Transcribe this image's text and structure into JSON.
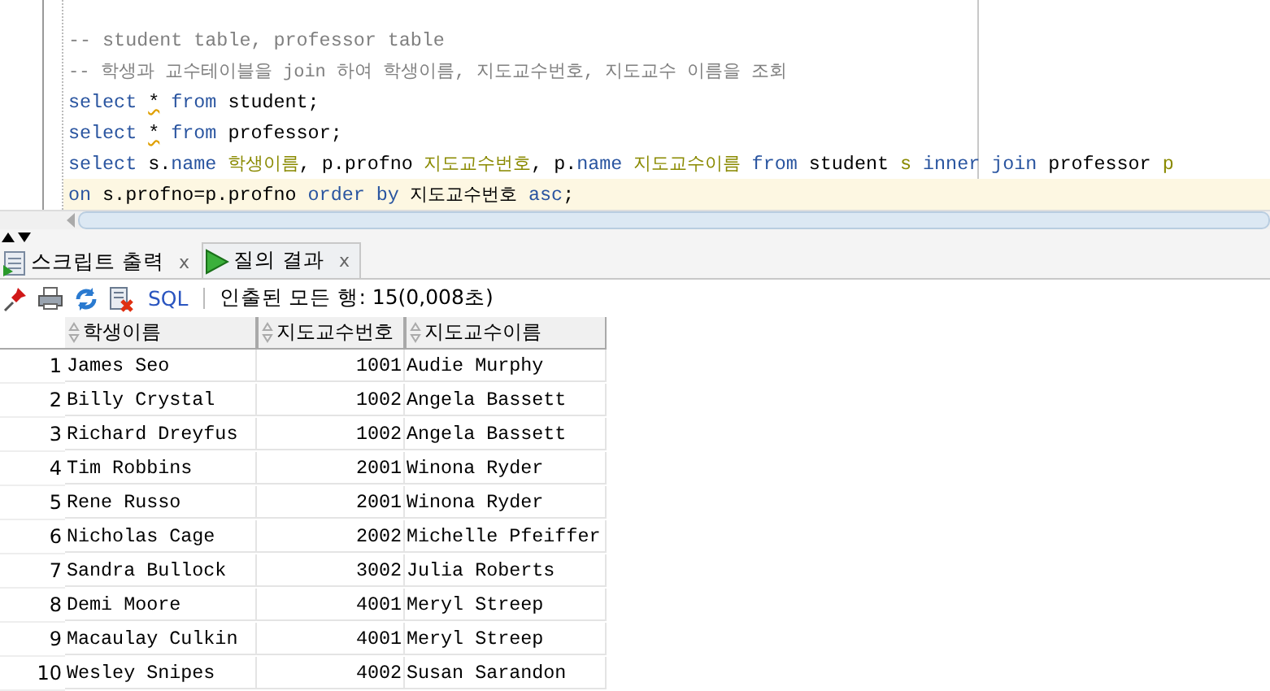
{
  "editor": {
    "lines": [
      {
        "current": false,
        "tokens": [
          {
            "kind": "comment",
            "text": "-- student table, professor table"
          }
        ]
      },
      {
        "current": false,
        "tokens": [
          {
            "kind": "comment",
            "text": "-- 학생과 교수테이블을 join 하여 학생이름, 지도교수번호, 지도교수 이름을 조회"
          }
        ]
      },
      {
        "current": false,
        "tokens": [
          {
            "kind": "keyword",
            "text": "select "
          },
          {
            "kind": "warning",
            "text": "*"
          },
          {
            "kind": "keyword",
            "text": " from"
          },
          {
            "kind": "plain",
            "text": " student;"
          }
        ]
      },
      {
        "current": false,
        "tokens": [
          {
            "kind": "keyword",
            "text": "select "
          },
          {
            "kind": "warning",
            "text": "*"
          },
          {
            "kind": "keyword",
            "text": " from"
          },
          {
            "kind": "plain",
            "text": " professor;"
          }
        ]
      },
      {
        "current": false,
        "tokens": [
          {
            "kind": "keyword",
            "text": "select"
          },
          {
            "kind": "plain",
            "text": " s."
          },
          {
            "kind": "keyword",
            "text": "name"
          },
          {
            "kind": "alias",
            "text": " 학생이름"
          },
          {
            "kind": "plain",
            "text": ", p.profno"
          },
          {
            "kind": "alias",
            "text": " 지도교수번호"
          },
          {
            "kind": "plain",
            "text": ", p."
          },
          {
            "kind": "keyword",
            "text": "name"
          },
          {
            "kind": "alias",
            "text": " 지도교수이름"
          },
          {
            "kind": "keyword",
            "text": " from"
          },
          {
            "kind": "plain",
            "text": " student"
          },
          {
            "kind": "alias",
            "text": " s"
          },
          {
            "kind": "keyword",
            "text": " inner join"
          },
          {
            "kind": "plain",
            "text": " professor"
          },
          {
            "kind": "alias",
            "text": " p"
          }
        ]
      },
      {
        "current": true,
        "tokens": [
          {
            "kind": "keyword",
            "text": "on"
          },
          {
            "kind": "plain",
            "text": " s.profno=p.profno"
          },
          {
            "kind": "keyword",
            "text": " order by"
          },
          {
            "kind": "plain",
            "text": " 지도교수번호"
          },
          {
            "kind": "keyword",
            "text": " asc"
          },
          {
            "kind": "plain",
            "text": ";"
          }
        ]
      }
    ]
  },
  "tabs": [
    {
      "label": "스크립트 출력",
      "close": "x",
      "selected": false,
      "kind": "script"
    },
    {
      "label": "질의 결과",
      "close": "x",
      "selected": true,
      "kind": "query"
    }
  ],
  "toolbar": {
    "sql_link": "SQL",
    "status": "인출된 모든 행: 15(0,008초)"
  },
  "table": {
    "columns": [
      "학생이름",
      "지도교수번호",
      "지도교수이름"
    ],
    "rows": [
      {
        "index": "1",
        "cells": [
          "James Seo",
          "1001",
          "Audie Murphy"
        ]
      },
      {
        "index": "2",
        "cells": [
          "Billy Crystal",
          "1002",
          "Angela Bassett"
        ]
      },
      {
        "index": "3",
        "cells": [
          "Richard Dreyfus",
          "1002",
          "Angela Bassett"
        ]
      },
      {
        "index": "4",
        "cells": [
          "Tim Robbins",
          "2001",
          "Winona Ryder"
        ]
      },
      {
        "index": "5",
        "cells": [
          "Rene Russo",
          "2001",
          "Winona Ryder"
        ]
      },
      {
        "index": "6",
        "cells": [
          "Nicholas Cage",
          "2002",
          "Michelle Pfeiffer"
        ]
      },
      {
        "index": "7",
        "cells": [
          "Sandra Bullock",
          "3002",
          "Julia Roberts"
        ]
      },
      {
        "index": "8",
        "cells": [
          "Demi Moore",
          "4001",
          "Meryl Streep"
        ]
      },
      {
        "index": "9",
        "cells": [
          "Macaulay Culkin",
          "4001",
          "Meryl Streep"
        ]
      },
      {
        "index": "10",
        "cells": [
          "Wesley Snipes",
          "4002",
          "Susan Sarandon"
        ]
      }
    ]
  }
}
